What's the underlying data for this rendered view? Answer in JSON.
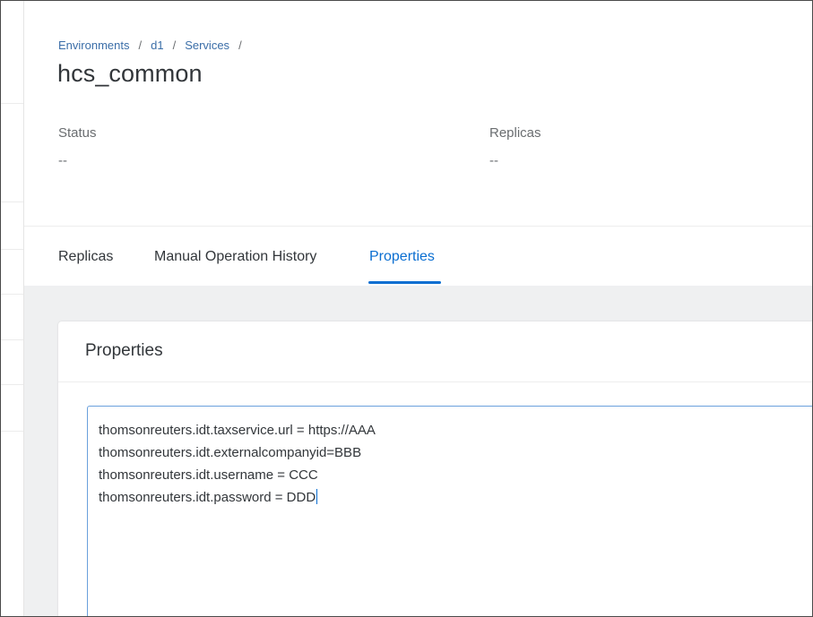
{
  "breadcrumb": {
    "items": [
      "Environments",
      "d1",
      "Services"
    ],
    "separator": "/"
  },
  "page": {
    "title": "hcs_common"
  },
  "attributes": {
    "status_label": "Status",
    "status_value": "--",
    "replicas_label": "Replicas",
    "replicas_value": "--"
  },
  "tabs": {
    "items": [
      "Replicas",
      "Manual Operation History",
      "Properties"
    ],
    "active": "Properties"
  },
  "properties_card": {
    "title": "Properties",
    "lines": [
      "thomsonreuters.idt.taxservice.url = https://AAA",
      "thomsonreuters.idt.externalcompanyid=BBB",
      "thomsonreuters.idt.username = CCC",
      "thomsonreuters.idt.password = DDD"
    ]
  },
  "colors": {
    "accent": "#0a6ed1",
    "link": "#3b6ea8",
    "text": "#32363a",
    "muted": "#6a6d70",
    "content_background": "#eff0f1"
  }
}
